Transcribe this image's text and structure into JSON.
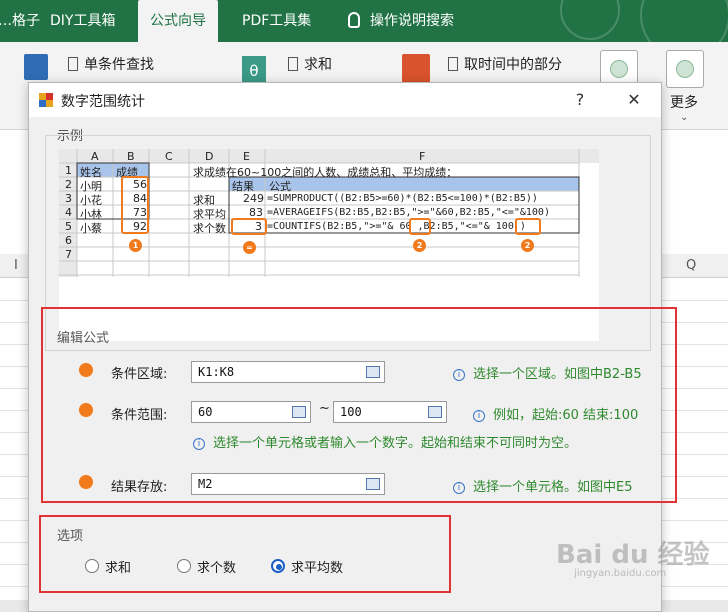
{
  "ribbon": {
    "tabs": [
      {
        "label": "…格子"
      },
      {
        "label": "DIY工具箱"
      },
      {
        "label": "公式向导"
      },
      {
        "label": "PDF工具集"
      },
      {
        "label": "操作说明搜索"
      }
    ],
    "groups": {
      "single_lookup": "单条件查找",
      "sum": "求和",
      "time_part": "取时间中的部分",
      "more": "更多"
    }
  },
  "sheet": {
    "col_i": "I",
    "col_q": "Q"
  },
  "dialog": {
    "title": "数字范围统计",
    "help": "?",
    "close": "✕",
    "example_label": "示例",
    "edit_formula_label": "编辑公式",
    "options_label": "选项",
    "fields": {
      "condition_area": {
        "label": "条件区域:",
        "value": "K1:K8",
        "hint": "选择一个区域。如图中B2-B5"
      },
      "condition_range": {
        "label": "条件范围:",
        "from": "60",
        "to": "100",
        "separator": "~",
        "hint": "例如，起始:60 结束:100",
        "hint2": "选择一个单元格或者输入一个数字。起始和结束不可同时为空。"
      },
      "result_store": {
        "label": "结果存放:",
        "value": "M2",
        "hint": "选择一个单元格。如图中E5"
      }
    },
    "options": [
      {
        "label": "求和",
        "checked": false
      },
      {
        "label": "求个数",
        "checked": false
      },
      {
        "label": "求平均数",
        "checked": true
      }
    ]
  },
  "example": {
    "col_headers": [
      "A",
      "B",
      "C",
      "D",
      "E",
      "F"
    ],
    "row_headers": [
      "1",
      "2",
      "3",
      "4",
      "5",
      "6",
      "7"
    ],
    "a1": "姓名",
    "b1": "成绩",
    "names": [
      "小明",
      "小花",
      "小林",
      "小蔡"
    ],
    "scores": [
      "56",
      "84",
      "73",
      "92"
    ],
    "d1": "求成绩在60~100之间的人数、成绩总和、平均成绩：",
    "e2": "结果",
    "f2": "公式",
    "rows": [
      {
        "label": "求和",
        "result": "249",
        "formula": "=SUMPRODUCT((B2:B5>=60)*(B2:B5<=100)*(B2:B5))"
      },
      {
        "label": "求平均",
        "result": "83",
        "formula": "=AVERAGEIFS(B2:B5,B2:B5,\">=\"&60,B2:B5,\"<=\"&100)"
      },
      {
        "label": "求个数",
        "result": "3",
        "formula": "=COUNTIFS(B2:B5,\">=\"& 60 ,B2:B5,\"<=\"& 100 )"
      }
    ],
    "badges": [
      "1",
      "=",
      "2",
      "2"
    ]
  },
  "watermark": {
    "text": "Bai du 经验",
    "sub": "jingyan.baidu.com"
  }
}
